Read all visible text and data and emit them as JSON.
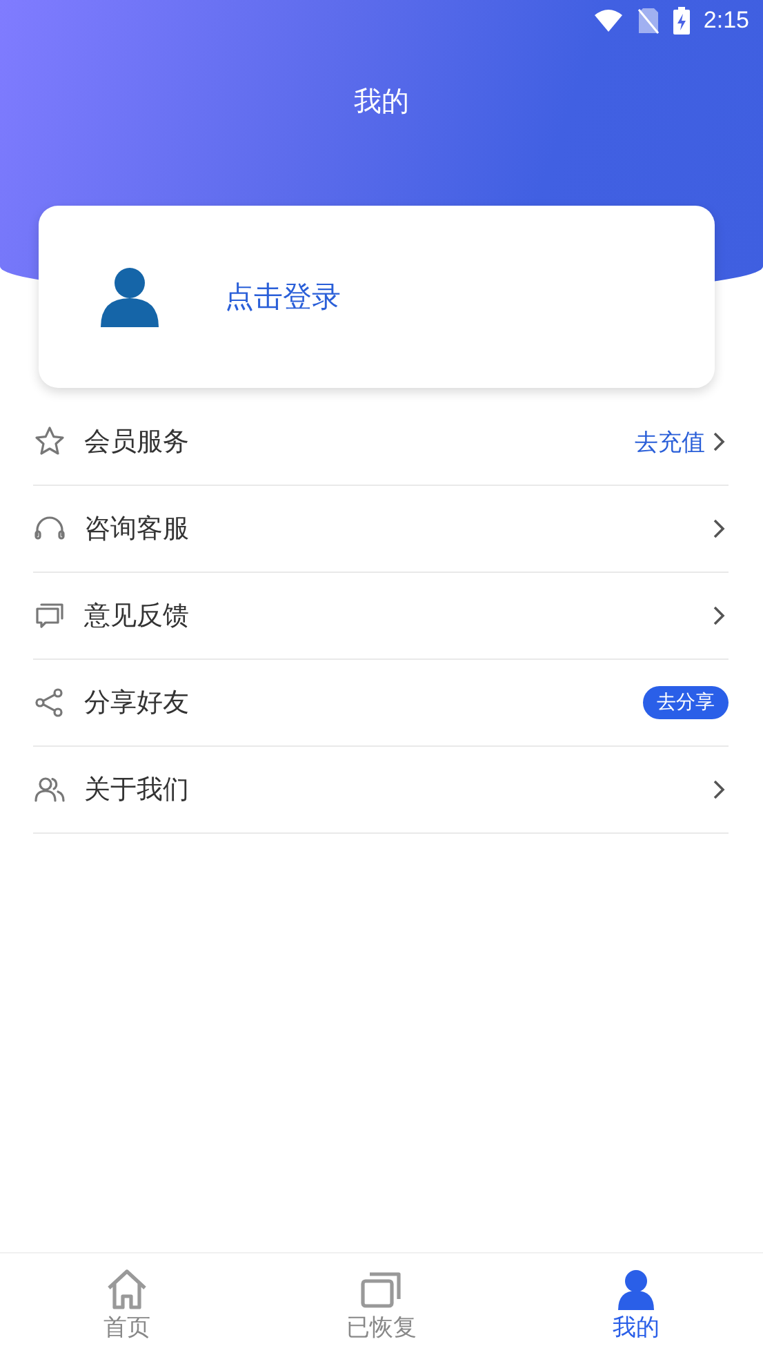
{
  "status_bar": {
    "time": "2:15"
  },
  "header": {
    "title": "我的"
  },
  "login_card": {
    "label": "点击登录"
  },
  "menu": [
    {
      "label": "会员服务",
      "kind": "link",
      "action": "去充值"
    },
    {
      "label": "咨询客服",
      "kind": "chevron"
    },
    {
      "label": "意见反馈",
      "kind": "chevron"
    },
    {
      "label": "分享好友",
      "kind": "badge",
      "action": "去分享"
    },
    {
      "label": "关于我们",
      "kind": "chevron"
    }
  ],
  "tab_bar": [
    {
      "label": "首页",
      "selected": false
    },
    {
      "label": "已恢复",
      "selected": false
    },
    {
      "label": "我的",
      "selected": true
    }
  ]
}
